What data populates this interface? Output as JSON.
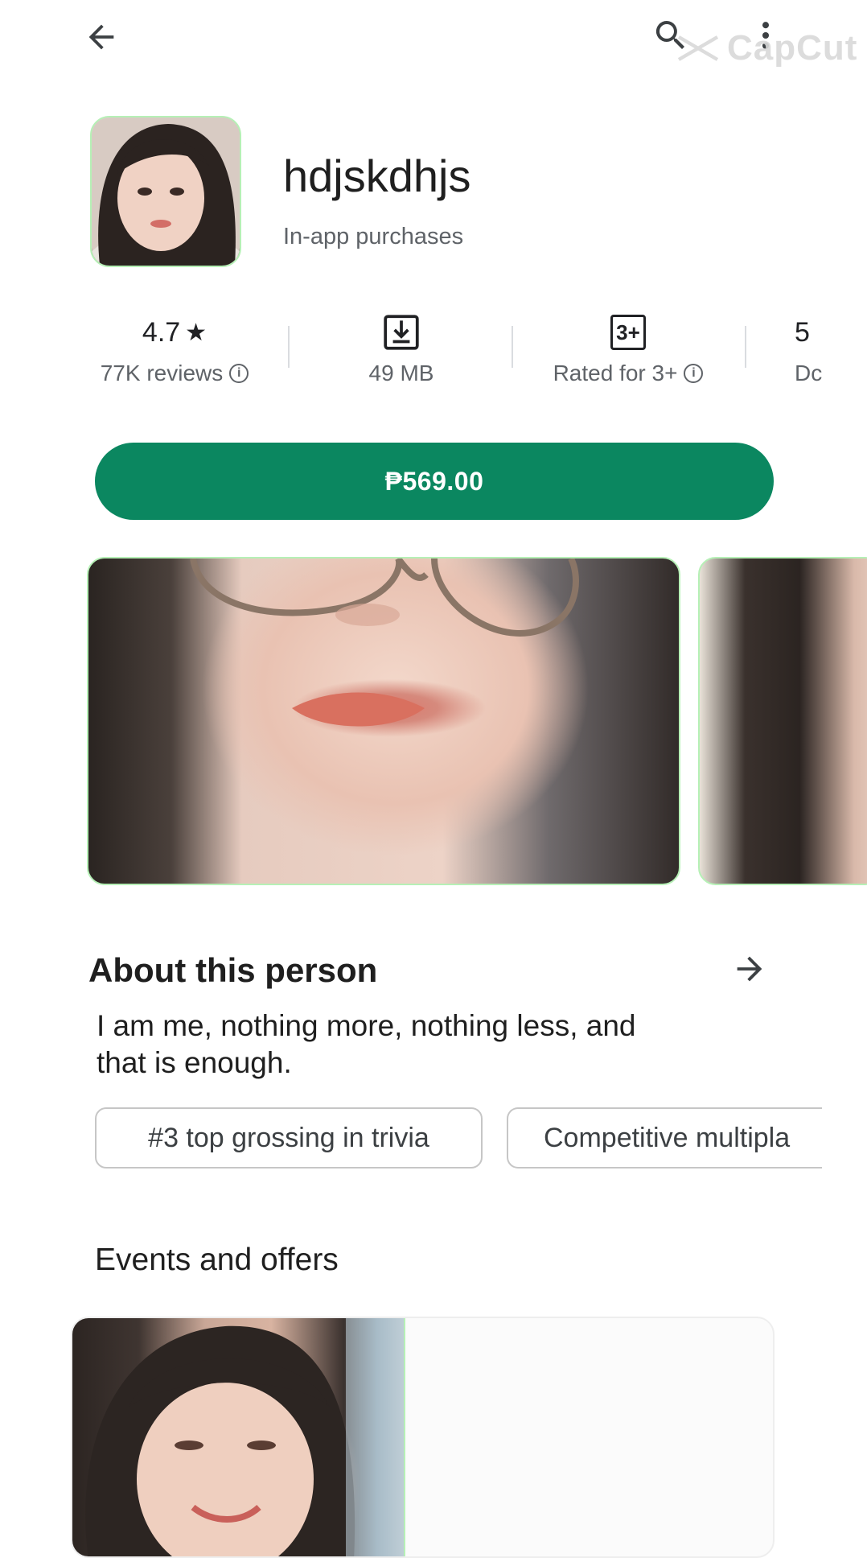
{
  "topbar": {
    "back_icon": "arrow-left-icon",
    "search_icon": "search-icon",
    "menu_icon": "more-vert-icon",
    "watermark": "CapCut"
  },
  "app": {
    "title": "hdjskdhjs",
    "subtitle": "In-app purchases"
  },
  "stats": {
    "rating_value": "4.7",
    "rating_star": "★",
    "reviews_label": "77K reviews",
    "size_label": "49 MB",
    "content_rating_badge": "3+",
    "content_rating_label": "Rated for 3+",
    "partial_top": "5",
    "partial_bottom": "Dc"
  },
  "buy": {
    "price_label": "₱569.00",
    "color": "#0b8760"
  },
  "about": {
    "title": "About this person",
    "description": "I am me, nothing more, nothing less, and that is enough."
  },
  "chips": [
    {
      "label": "#3 top grossing in trivia"
    },
    {
      "label": "Competitive multipla"
    }
  ],
  "events": {
    "title": "Events and offers"
  }
}
